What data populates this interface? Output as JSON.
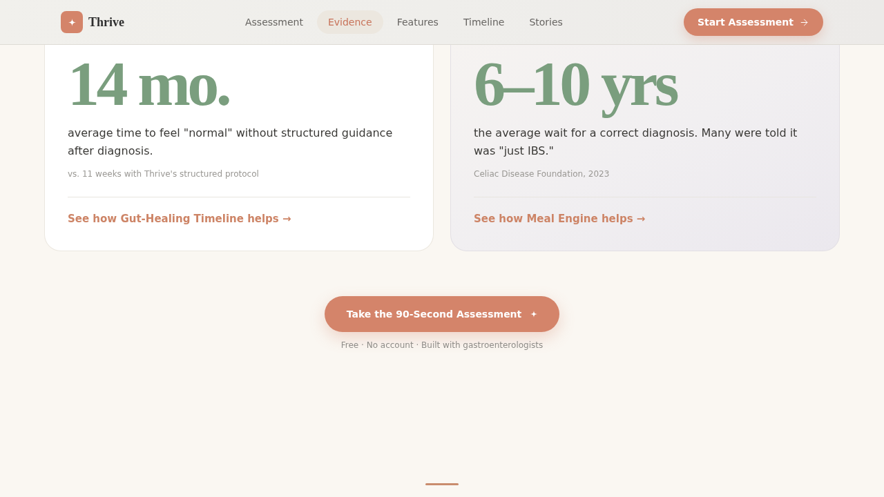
{
  "header": {
    "brand": "Thrive",
    "nav": [
      {
        "label": "Assessment",
        "selected": false
      },
      {
        "label": "Evidence",
        "selected": true
      },
      {
        "label": "Features",
        "selected": false
      },
      {
        "label": "Timeline",
        "selected": false
      },
      {
        "label": "Stories",
        "selected": false
      }
    ],
    "cta": "Start Assessment"
  },
  "stats": [
    {
      "kind": "plain",
      "figure": "14 mo.",
      "description": "average time to feel \"normal\" without structured guidance after diagnosis.",
      "note": "vs. 11 weeks with Thrive's structured protocol",
      "link": "See how Gut-Healing Timeline helps →"
    },
    {
      "kind": "tinted",
      "figure": "6–10 yrs",
      "description": "the average wait for a correct diagnosis. Many were told it was \"just IBS.\"",
      "note": "Celiac Disease Foundation, 2023",
      "link": "See how Meal Engine helps →"
    }
  ],
  "cta": {
    "label": "Take the 90-Second Assessment",
    "note": "Free · No account · Built with gastroenterologists"
  }
}
